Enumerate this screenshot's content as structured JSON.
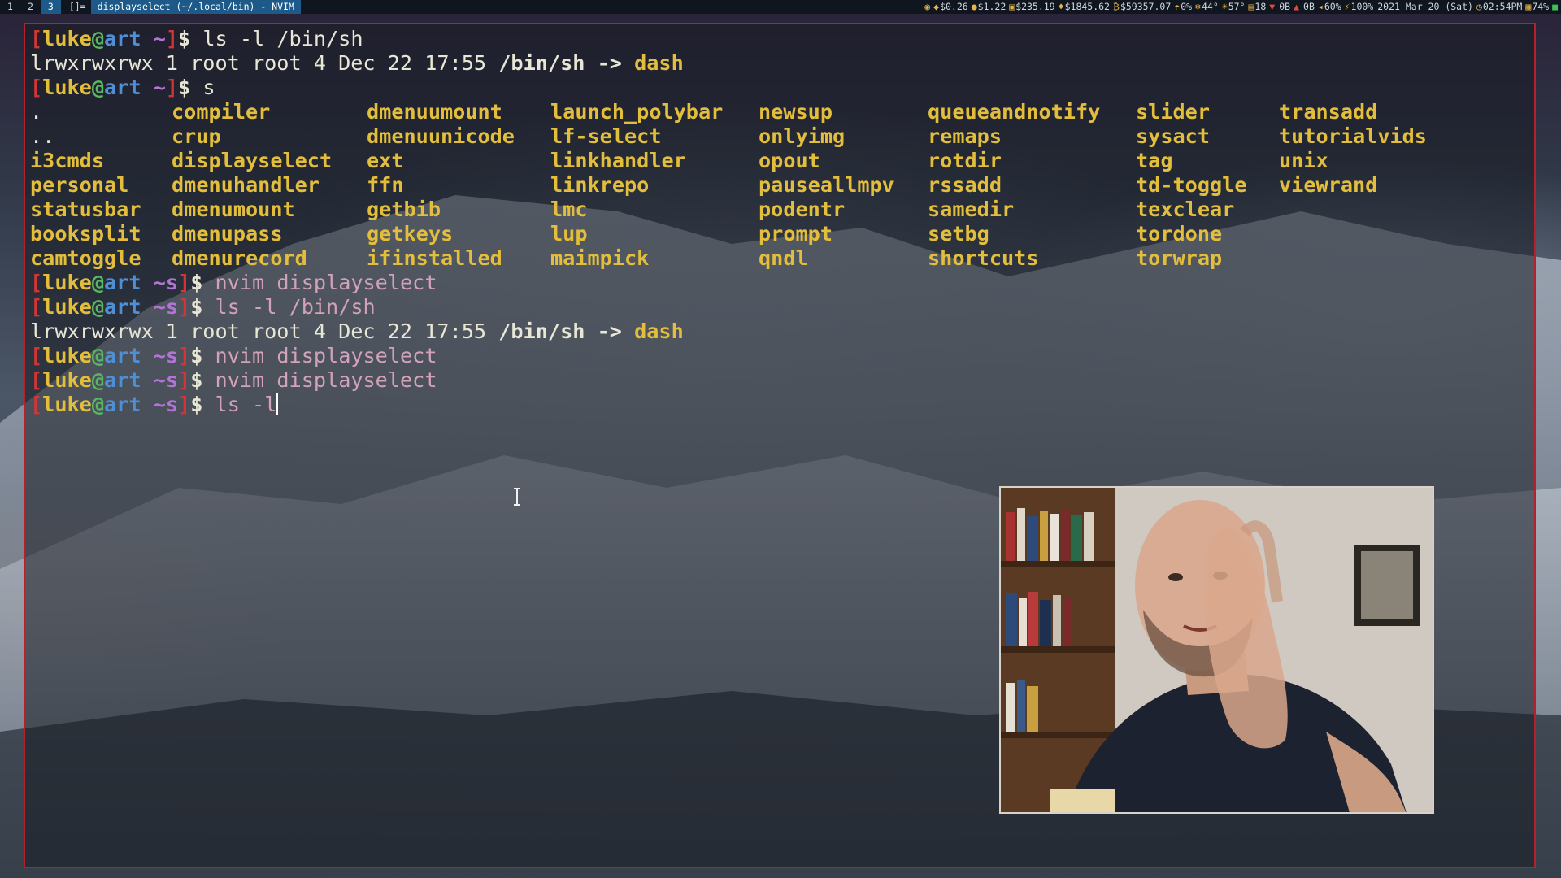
{
  "topbar": {
    "workspaces": [
      "1",
      "2",
      "3"
    ],
    "active_workspace": "3",
    "layout_symbol": "[]=",
    "window_title": "displayselect (~/.local/bin) - NVIM",
    "status_items": [
      {
        "icon": "record-icon",
        "text": ""
      },
      {
        "icon": "crypto-icon",
        "text": "$0.26"
      },
      {
        "icon": "coin-icon",
        "text": "$1.22"
      },
      {
        "icon": "lock-icon",
        "text": "$235.19"
      },
      {
        "icon": "ethereum-icon",
        "text": "$1845.62"
      },
      {
        "icon": "bitcoin-icon",
        "text": "$59357.07"
      },
      {
        "icon": "rain-icon",
        "text": "0%"
      },
      {
        "icon": "cold-icon",
        "text": "44°"
      },
      {
        "icon": "sun-icon",
        "text": "57°"
      },
      {
        "icon": "package-icon",
        "text": "18"
      },
      {
        "icon": "down-arrow-icon",
        "text": ""
      },
      {
        "icon": "",
        "text": "0B"
      },
      {
        "icon": "up-arrow-icon",
        "text": ""
      },
      {
        "icon": "",
        "text": "0B"
      },
      {
        "icon": "volume-icon",
        "text": "60%"
      },
      {
        "icon": "battery-charging-icon",
        "text": "100%"
      },
      {
        "icon": "",
        "text": "2021 Mar 20 (Sat)"
      },
      {
        "icon": "clock-icon",
        "text": "02:54PM"
      },
      {
        "icon": "memory-icon",
        "text": "74%"
      },
      {
        "icon": "network-icon",
        "text": ""
      }
    ]
  },
  "terminal": {
    "prompt": {
      "open": "[",
      "user": "luke",
      "at": "@",
      "host": "art",
      "cwd_home": "~",
      "cwd_scripts": "~s",
      "close": "]",
      "dollar": "$"
    },
    "lines": [
      {
        "type": "prompt",
        "cwd": "~",
        "cmd": "ls -l /bin/sh",
        "style": "plain"
      },
      {
        "type": "ls",
        "perm": "lrwxrwxrwx 1 root root 4 Dec 22 17:55 ",
        "link": "/bin/sh",
        "arrow": " -> ",
        "target": "dash"
      },
      {
        "type": "prompt",
        "cwd": "~",
        "cmd": "s",
        "style": "plain"
      },
      {
        "type": "prompt",
        "cwd": "~s",
        "cmd": "nvim displayselect",
        "style": "pink"
      },
      {
        "type": "prompt",
        "cwd": "~s",
        "cmd": "ls -l /bin/sh",
        "style": "pink"
      },
      {
        "type": "ls",
        "perm": "lrwxrwxrwx 1 root root 4 Dec 22 17:55 ",
        "link": "/bin/sh",
        "arrow": " -> ",
        "target": "dash"
      },
      {
        "type": "prompt",
        "cwd": "~s",
        "cmd": "nvim displayselect",
        "style": "pink"
      },
      {
        "type": "prompt",
        "cwd": "~s",
        "cmd": "nvim displayselect",
        "style": "pink"
      },
      {
        "type": "prompt",
        "cwd": "~s",
        "cmd": "ls -l",
        "style": "pink",
        "cursor": true
      }
    ],
    "listing": [
      [
        ".",
        "compiler",
        "dmenuumount",
        "launch_polybar",
        "newsup",
        "queueandnotify",
        "slider",
        "transadd"
      ],
      [
        "..",
        "crup",
        "dmenuunicode",
        "lf-select",
        "onlyimg",
        "remaps",
        "sysact",
        "tutorialvids"
      ],
      [
        "i3cmds",
        "displayselect",
        "ext",
        "linkhandler",
        "opout",
        "rotdir",
        "tag",
        "unix"
      ],
      [
        "personal",
        "dmenuhandler",
        "ffn",
        "linkrepo",
        "pauseallmpv",
        "rssadd",
        "td-toggle",
        "viewrand"
      ],
      [
        "statusbar",
        "dmenumount",
        "getbib",
        "lmc",
        "podentr",
        "samedir",
        "texclear",
        ""
      ],
      [
        "booksplit",
        "dmenupass",
        "getkeys",
        "lup",
        "prompt",
        "setbg",
        "tordone",
        ""
      ],
      [
        "camtoggle",
        "dmenurecord",
        "ifinstalled",
        "maimpick",
        "qndl",
        "shortcuts",
        "torwrap",
        ""
      ]
    ]
  },
  "colors": {
    "border": "#b6202a",
    "user": "#e2be3c",
    "host": "#4f8fd6",
    "cwd": "#b474d6",
    "bracket": "#d23535",
    "at": "#57b860",
    "listing": "#e2be3c",
    "pink_cmd": "#d2a2b8"
  }
}
